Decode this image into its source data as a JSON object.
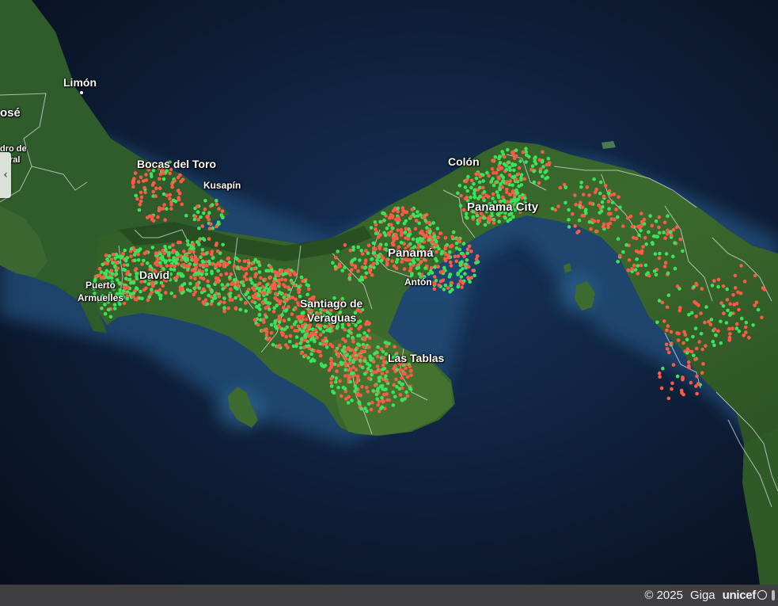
{
  "map": {
    "labels": {
      "limon": "Limón",
      "jose": "osé",
      "pedro": "dro de",
      "ral": "ral",
      "bocas": "Bocas del Toro",
      "kusapin": "Kusapín",
      "colon": "Colón",
      "panama_city": "Panama City",
      "panama": "Panamá",
      "anton": "Antón",
      "puerto": "Puerto",
      "armuelles": "Armuelles",
      "david": "David",
      "santiago1": "Santiago de",
      "santiago2": "Veraguas",
      "las_tablas": "Las Tablas"
    },
    "legend_colors": {
      "connected": "#3be35b",
      "not_connected": "#ff5a47"
    }
  },
  "controls": {
    "collapse_icon": "chevron-left-icon",
    "collapse_glyph": "‹"
  },
  "footer": {
    "copyright": "© 2025",
    "giga": "Giga",
    "unicef": "unicef"
  }
}
